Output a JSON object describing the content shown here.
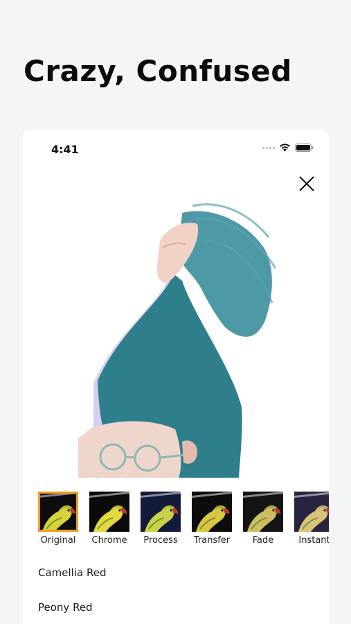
{
  "headline": "Crazy, Confused",
  "status": {
    "time": "4:41"
  },
  "filters": [
    {
      "label": "Original",
      "selected": true,
      "bg": "#0d0d0d",
      "tint": "#d7d33a"
    },
    {
      "label": "Chrome",
      "selected": false,
      "bg": "#0a0a0a",
      "tint": "#e3d840"
    },
    {
      "label": "Process",
      "selected": false,
      "bg": "#141b3a",
      "tint": "#c9d24a"
    },
    {
      "label": "Transfer",
      "selected": false,
      "bg": "#0c0c0c",
      "tint": "#d6c640"
    },
    {
      "label": "Fade",
      "selected": false,
      "bg": "#141414",
      "tint": "#cdbd62"
    },
    {
      "label": "Instant",
      "selected": false,
      "bg": "#2a2440",
      "tint": "#d9c27a"
    }
  ],
  "list": [
    {
      "label": "Camellia Red"
    },
    {
      "label": "Peony Red"
    }
  ],
  "colors": {
    "selected_outline": "#f29b1d",
    "hair": "#2f7e8c"
  }
}
